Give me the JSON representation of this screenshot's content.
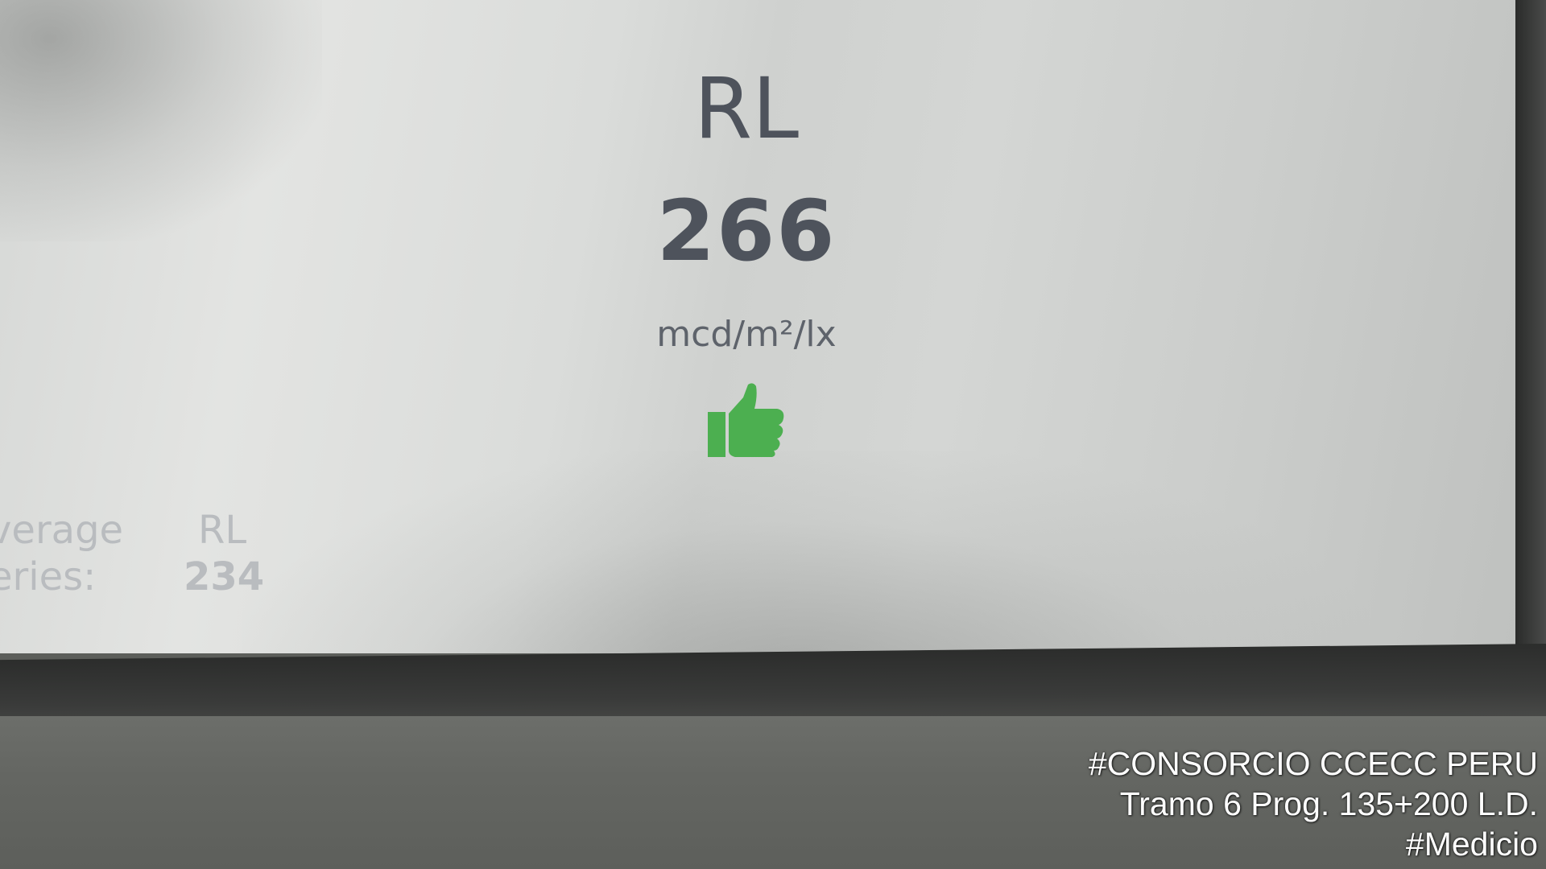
{
  "display": {
    "metric_title": "RL",
    "metric_value": "266",
    "metric_unit": "mcd/m²/lx",
    "status_icon": "thumbs-up-icon",
    "status_color": "#4caf50"
  },
  "average": {
    "label_line1": "verage",
    "label_line2": "eries:",
    "metric": "RL",
    "value": "234"
  },
  "watermark": {
    "line1": "#CONSORCIO CCECC PERU",
    "line2": "Tramo 6 Prog. 135+200 L.D.",
    "line3": "#Medicio"
  }
}
